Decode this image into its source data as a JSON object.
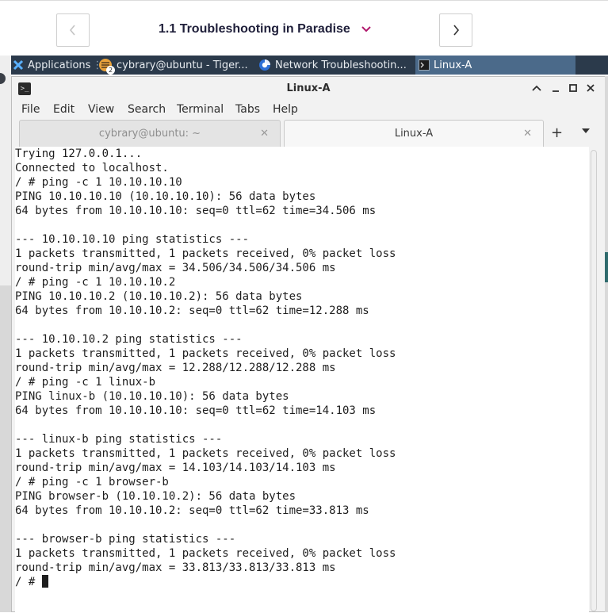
{
  "course_nav": {
    "title": "1.1 Troubleshooting in Paradise",
    "prev_icon": "chevron-left-icon",
    "next_icon": "chevron-right-icon",
    "dropdown_icon": "chevron-down-icon",
    "accent_color": "#b0186c"
  },
  "taskbar": {
    "apps": [
      {
        "label": "Applications",
        "icon": "xfce-logo-icon",
        "active": false
      },
      {
        "label": "cybrary@ubuntu - Tiger...",
        "icon": "vnc-tiger-icon",
        "badge": "2",
        "active": false
      },
      {
        "label": "Network Troubleshootin...",
        "icon": "browser-icon",
        "active": false
      },
      {
        "label": "Linux-A",
        "icon": "terminal-icon",
        "active": true
      }
    ]
  },
  "window": {
    "title": "Linux-A",
    "controls": [
      "chevron-up-icon",
      "minimize-icon",
      "maximize-icon",
      "close-icon"
    ]
  },
  "menu": {
    "items": [
      "File",
      "Edit",
      "View",
      "Search",
      "Terminal",
      "Tabs",
      "Help"
    ]
  },
  "tabs": [
    {
      "label": "cybrary@ubuntu: ~",
      "active": false
    },
    {
      "label": "Linux-A",
      "active": true
    }
  ],
  "terminal": {
    "lines": [
      "Trying 127.0.0.1...",
      "Connected to localhost.",
      "/ # ping -c 1 10.10.10.10",
      "PING 10.10.10.10 (10.10.10.10): 56 data bytes",
      "64 bytes from 10.10.10.10: seq=0 ttl=62 time=34.506 ms",
      "",
      "--- 10.10.10.10 ping statistics ---",
      "1 packets transmitted, 1 packets received, 0% packet loss",
      "round-trip min/avg/max = 34.506/34.506/34.506 ms",
      "/ # ping -c 1 10.10.10.2",
      "PING 10.10.10.2 (10.10.10.2): 56 data bytes",
      "64 bytes from 10.10.10.2: seq=0 ttl=62 time=12.288 ms",
      "",
      "--- 10.10.10.2 ping statistics ---",
      "1 packets transmitted, 1 packets received, 0% packet loss",
      "round-trip min/avg/max = 12.288/12.288/12.288 ms",
      "/ # ping -c 1 linux-b",
      "PING linux-b (10.10.10.10): 56 data bytes",
      "64 bytes from 10.10.10.10: seq=0 ttl=62 time=14.103 ms",
      "",
      "--- linux-b ping statistics ---",
      "1 packets transmitted, 1 packets received, 0% packet loss",
      "round-trip min/avg/max = 14.103/14.103/14.103 ms",
      "/ # ping -c 1 browser-b",
      "PING browser-b (10.10.10.2): 56 data bytes",
      "64 bytes from 10.10.10.2: seq=0 ttl=62 time=33.813 ms",
      "",
      "--- browser-b ping statistics ---",
      "1 packets transmitted, 1 packets received, 0% packet loss",
      "round-trip min/avg/max = 33.813/33.813/33.813 ms"
    ],
    "prompt": "/ # "
  }
}
